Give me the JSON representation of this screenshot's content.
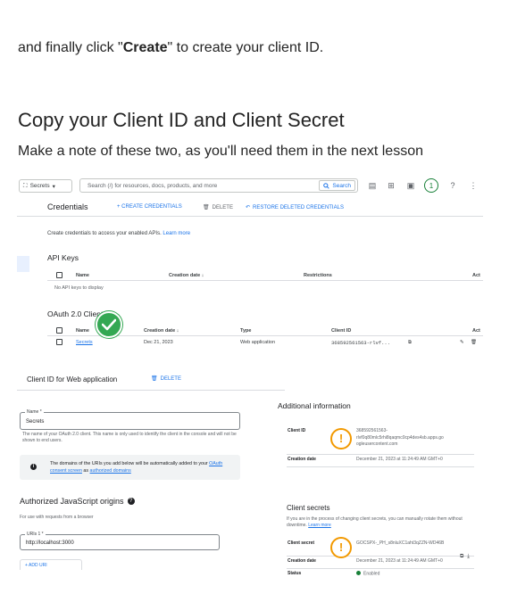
{
  "intro": {
    "before": "and finally click \"",
    "bold": "Create",
    "after": "\" to create your client ID."
  },
  "heading": "Copy your Client ID and Client Secret",
  "lead": "Make a note of these two, as you'll need them in the next lesson",
  "screenshot1": {
    "project_label": "Secrets",
    "search_placeholder": "Search (/) for resources, docs, products, and more",
    "search_button": "Search",
    "step_badge": "1",
    "credentials_title": "Credentials",
    "create_credentials": "+ CREATE CREDENTIALS",
    "delete": "DELETE",
    "restore": "RESTORE DELETED CREDENTIALS",
    "description": "Create credentials to access your enabled APIs.",
    "learn_more": "Learn more",
    "api_keys_title": "API Keys",
    "api_keys_headers": {
      "name": "Name",
      "creation_date": "Creation date",
      "restrictions": "Restrictions",
      "actions": "Act"
    },
    "api_keys_empty": "No API keys to display",
    "oauth_title": "OAuth 2.0 Client IDs",
    "oauth_headers": {
      "name": "Name",
      "creation_date": "Creation date",
      "type": "Type",
      "client_id": "Client ID",
      "actions": "Act"
    },
    "oauth_row": {
      "name": "Secrets",
      "creation_date": "Dec 21, 2023",
      "type": "Web application",
      "client_id": "368592561563-rlvf..."
    }
  },
  "screenshot2": {
    "client_id_title": "Client ID for Web application",
    "delete": "DELETE",
    "name_label": "Name *",
    "name_value": "Secrets",
    "name_help": "The name of your OAuth 2.0 client. This name is only used to identify the client in the console and will not be shown to end users.",
    "info_text": "The domains of the URIs you add below will be automatically added to your",
    "info_link1": "OAuth consent screen",
    "info_as": "as",
    "info_link2": "authorized domains",
    "js_origins_title": "Authorized JavaScript origins",
    "js_origins_help": "For use with requests from a browser",
    "uri_label": "URIs 1 *",
    "uri_value": "http://localhost:3000",
    "add_uri": "+ ADD URI",
    "additional_info_title": "Additional information",
    "client_id_key": "Client ID",
    "client_id_value_1": "368592561563-",
    "client_id_value_2": "rlvf0q80mlc5rhi8qaqmc0cp4des4sb.apps.go",
    "client_id_value_3": "ogleusercontent.com",
    "creation_date_key": "Creation date",
    "creation_date_value": "December 21, 2023 at 11:24:49 AM GMT+0",
    "client_secrets_title": "Client secrets",
    "client_secrets_help": "If you are in the process of changing client secrets, you can manually rotate them without downtime.",
    "client_secrets_learn_more": "Learn more",
    "client_secret_key": "Client secret",
    "client_secret_value": "GOCSPX-_PH_s8nluXC1aht3qZZN-WD46B",
    "secret_creation_date_key": "Creation date",
    "secret_creation_date_value": "December 21, 2023 at 11:24:49 AM GMT+0",
    "status_key": "Status",
    "status_value": "Enabled"
  },
  "colors": {
    "google_blue": "#1a73e8",
    "success_green": "#34a853",
    "alert_orange": "#f29900"
  }
}
